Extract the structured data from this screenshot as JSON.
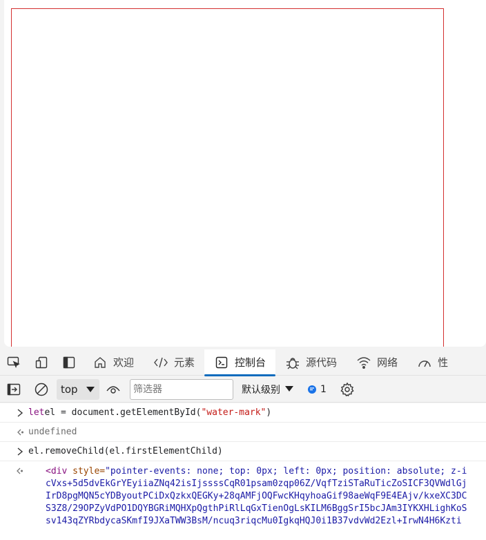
{
  "devtools": {
    "tabs": [
      {
        "label": "欢迎",
        "icon": "home-icon"
      },
      {
        "label": "元素",
        "icon": "code-icon"
      },
      {
        "label": "控制台",
        "icon": "console-icon",
        "active": true
      },
      {
        "label": "源代码",
        "icon": "bug-icon"
      },
      {
        "label": "网络",
        "icon": "wifi-icon"
      },
      {
        "label": "性",
        "icon": "performance-icon"
      }
    ],
    "toolbar": {
      "context": "top",
      "filter_placeholder": "筛选器",
      "levels": "默认级别",
      "issues_count": "1"
    }
  },
  "console": {
    "lines": [
      {
        "type": "input",
        "keyword": "let",
        "code": " el = document.getElementById(",
        "string": "\"water-mark\"",
        "close": ")"
      },
      {
        "type": "output",
        "text": "undefined"
      },
      {
        "type": "input",
        "code": "el.removeChild(el.firstElementChild)"
      }
    ],
    "result": {
      "tag_open": "<div",
      "attr_name": " style=",
      "attr_value_start": "\"pointer-events: none; top: 0px; left: 0px; position: absolute; z-i",
      "lines": [
        "cVxs+5d5dvEkGrYEyiiaZNq42isIjssssCqR01psam0zqp06Z/VqfTziSTaRuTicZoSICF3QVWdlGj",
        "IrD8pgMQN5cYDByoutPCiDxQzkxQEGKy+28qAMFjOQFwcKHqyhoaGif98aeWqF9E4EAjv/kxeXC3DC",
        "S3Z8/29OPZyVdPO1DQYBGRiMQHXpQgthPiRlLqGxTienOgLsKILM6BggSrI5bcJAm3IYKXHLighKoS",
        "sv143qZYRbdycaSKmfI9JXaTWW3BsM/ncuq3riqcMu0IgkqHQJ0i1B37vdvWd2Ezl+IrwN4H6Kzti"
      ]
    }
  }
}
